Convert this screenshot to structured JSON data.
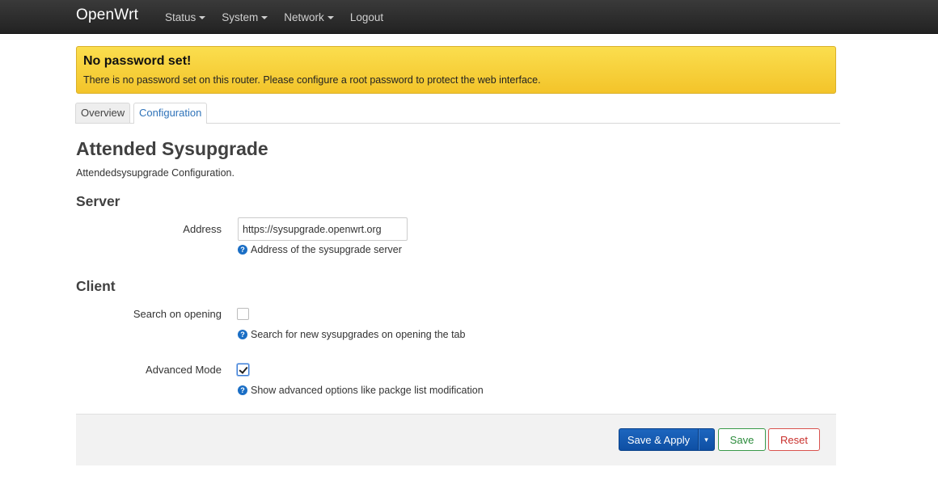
{
  "header": {
    "brand": "OpenWrt",
    "menu": [
      {
        "label": "Status",
        "has_dropdown": true
      },
      {
        "label": "System",
        "has_dropdown": true
      },
      {
        "label": "Network",
        "has_dropdown": true
      },
      {
        "label": "Logout",
        "has_dropdown": false
      }
    ]
  },
  "alert": {
    "title": "No password set!",
    "text": "There is no password set on this router. Please configure a root password to protect the web interface.",
    "color": "#f3c42a"
  },
  "tabs": [
    {
      "label": "Overview",
      "active": false
    },
    {
      "label": "Configuration",
      "active": true
    }
  ],
  "page": {
    "title": "Attended Sysupgrade",
    "description": "Attendedsysupgrade Configuration."
  },
  "server": {
    "heading": "Server",
    "address_label": "Address",
    "address_value": "https://sysupgrade.openwrt.org",
    "address_help": "Address of the sysupgrade server"
  },
  "client": {
    "heading": "Client",
    "search_label": "Search on opening",
    "search_checked": false,
    "search_help": "Search for new sysupgrades on opening the tab",
    "advanced_label": "Advanced Mode",
    "advanced_checked": true,
    "advanced_help": "Show advanced options like packge list modification"
  },
  "actions": {
    "save_apply": "Save & Apply",
    "dropdown_glyph": "▾",
    "save": "Save",
    "reset": "Reset",
    "primary_color": "#1d66bf",
    "save_color": "#3a9a4a",
    "reset_color": "#d9534f"
  },
  "icons": {
    "help": "question-circle-icon",
    "help_glyph": "?"
  }
}
